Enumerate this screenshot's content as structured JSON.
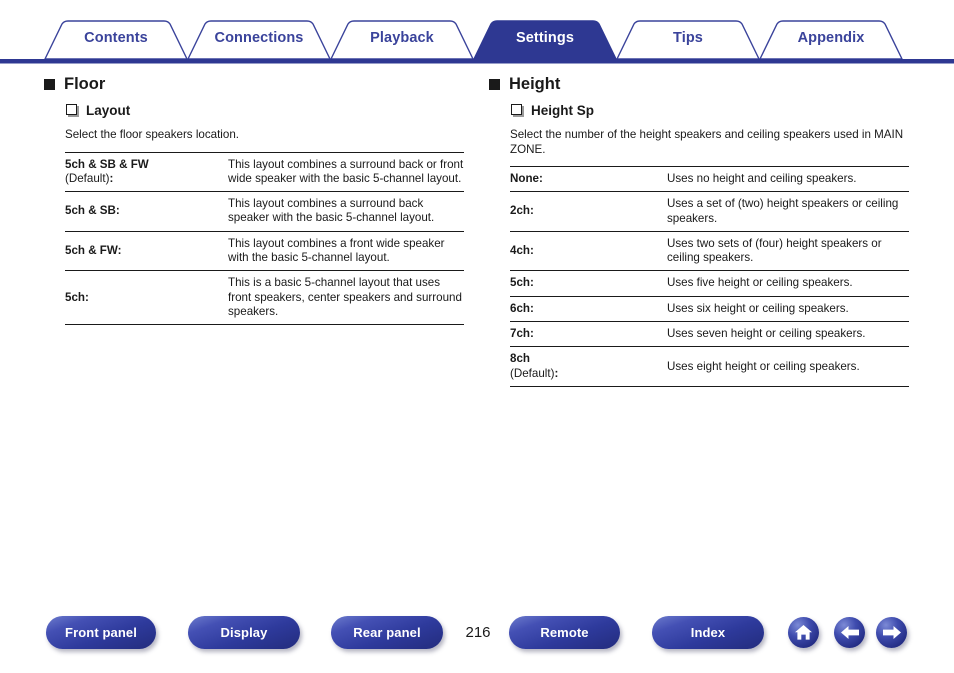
{
  "nav": {
    "tabs": [
      {
        "label": "Contents",
        "active": false
      },
      {
        "label": "Connections",
        "active": false
      },
      {
        "label": "Playback",
        "active": false
      },
      {
        "label": "Settings",
        "active": true
      },
      {
        "label": "Tips",
        "active": false
      },
      {
        "label": "Appendix",
        "active": false
      }
    ],
    "accent_color": "#3a439b",
    "active_fill": "#2e3892"
  },
  "left": {
    "section_title": "Floor",
    "sub_title": "Layout",
    "intro": "Select the floor speakers location.",
    "rows": [
      {
        "term": "5ch & SB & FW",
        "default_label": "(Default)",
        "default_colon": ":",
        "desc": "This layout combines a surround back or front wide speaker with the basic 5-channel layout."
      },
      {
        "term": "5ch & SB:",
        "default_label": "",
        "default_colon": "",
        "desc": "This layout combines a surround back speaker with the basic 5-channel layout."
      },
      {
        "term": "5ch & FW:",
        "default_label": "",
        "default_colon": "",
        "desc": "This layout combines a front wide speaker with the basic 5-channel layout."
      },
      {
        "term": "5ch:",
        "default_label": "",
        "default_colon": "",
        "desc": "This is a basic 5-channel layout that uses front speakers, center speakers and surround speakers."
      }
    ]
  },
  "right": {
    "section_title": "Height",
    "sub_title": "Height Sp",
    "intro": "Select the number of the height speakers and ceiling speakers used in MAIN ZONE.",
    "rows": [
      {
        "term": "None:",
        "default_label": "",
        "default_colon": "",
        "desc": "Uses no height and ceiling speakers."
      },
      {
        "term": "2ch:",
        "default_label": "",
        "default_colon": "",
        "desc": "Uses a set of (two) height speakers or ceiling speakers."
      },
      {
        "term": "4ch:",
        "default_label": "",
        "default_colon": "",
        "desc": "Uses two sets of (four) height speakers or ceiling speakers."
      },
      {
        "term": "5ch:",
        "default_label": "",
        "default_colon": "",
        "desc": "Uses five height or ceiling speakers."
      },
      {
        "term": "6ch:",
        "default_label": "",
        "default_colon": "",
        "desc": "Uses six height or ceiling speakers."
      },
      {
        "term": "7ch:",
        "default_label": "",
        "default_colon": "",
        "desc": "Uses seven height or ceiling speakers."
      },
      {
        "term": "8ch",
        "default_label": "(Default)",
        "default_colon": ":",
        "desc": "Uses eight height or ceiling speakers."
      }
    ]
  },
  "footer": {
    "buttons": [
      {
        "label": "Front panel"
      },
      {
        "label": "Display"
      },
      {
        "label": "Rear panel"
      },
      {
        "label": "Remote"
      },
      {
        "label": "Index"
      }
    ],
    "page_number": "216",
    "icons": [
      {
        "name": "home-icon"
      },
      {
        "name": "arrow-left-icon"
      },
      {
        "name": "arrow-right-icon"
      }
    ]
  }
}
